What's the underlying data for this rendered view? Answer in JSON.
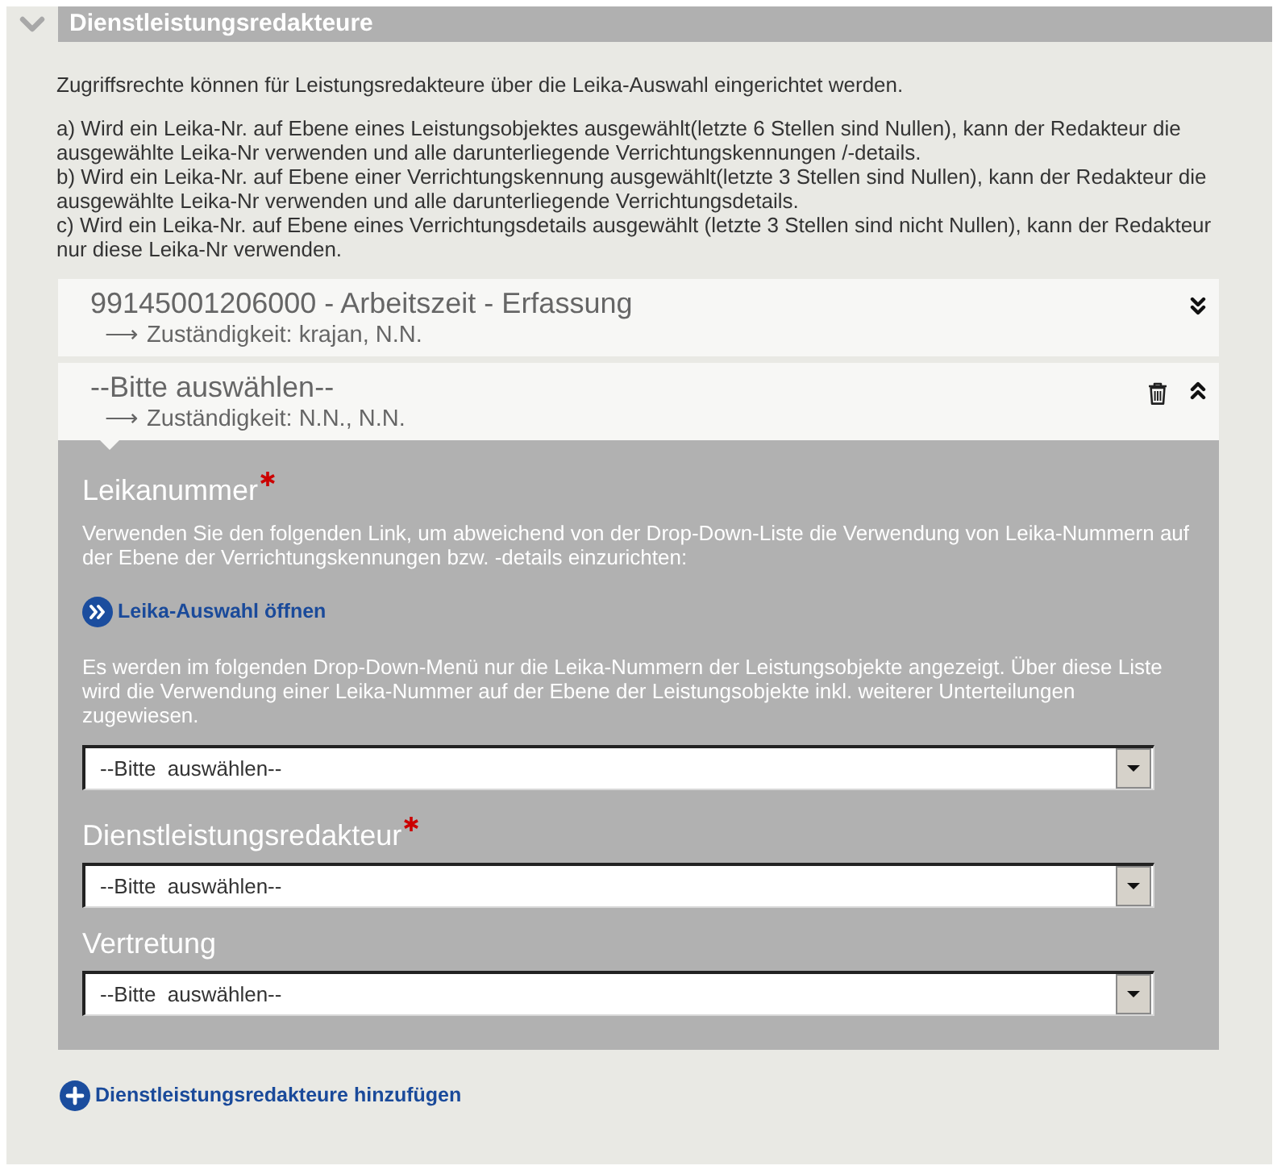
{
  "section": {
    "title": "Dienstleistungsredakteure",
    "expanded": true
  },
  "intro": "Zugriffsrechte können für Leistungsredakteure über die Leika-Auswahl eingerichtet werden.",
  "rules": [
    "a) Wird ein Leika-Nr. auf Ebene eines Leistungsobjektes ausgewählt(letzte 6 Stellen sind Nullen), kann der Redakteur die ausgewählte Leika-Nr verwenden und alle darunterliegende Verrichtungskennungen /-details.",
    "b) Wird ein Leika-Nr. auf Ebene einer Verrichtungskennung ausgewählt(letzte 3 Stellen sind Nullen), kann der Redakteur die ausgewählte Leika-Nr verwenden und alle darunterliegende Verrichtungsdetails.",
    "c) Wird ein Leika-Nr. auf Ebene eines Verrichtungsdetails ausgewählt (letzte 3 Stellen sind nicht Nullen), kann der Redakteur nur diese Leika-Nr verwenden."
  ],
  "entries": [
    {
      "title": "99145001206000 - Arbeitszeit - Erfassung",
      "responsibility": "⟶ Zuständigkeit: krajan, N.N.",
      "expanded": false,
      "deletable": false
    },
    {
      "title": "--Bitte auswählen--",
      "responsibility": "⟶ Zuständigkeit: N.N., N.N.",
      "expanded": true,
      "deletable": true,
      "form": {
        "fields": [
          {
            "label": "Leikanummer",
            "required": true,
            "help": "Verwenden Sie den folgenden Link, um abweichend von der Drop-Down-Liste die Verwendung von Leika-Nummern auf der Ebene der Verrichtungskennungen bzw. -details einzurichten:",
            "link": "Leika-Auswahl öffnen",
            "note": "Es werden im folgenden Drop-Down-Menü nur die Leika-Nummern der Leistungsobjekte angezeigt. Über diese Liste wird die Verwendung einer Leika-Nummer auf der Ebene der Leistungsobjekte inkl. weiterer Unterteilungen zugewiesen.",
            "select": {
              "value": "--Bitte  auswählen--"
            }
          },
          {
            "label": "Dienstleistungsredakteur",
            "required": true,
            "select": {
              "value": "--Bitte  auswählen--"
            }
          },
          {
            "label": "Vertretung",
            "required": false,
            "select": {
              "value": "--Bitte  auswählen--"
            }
          }
        ]
      }
    }
  ],
  "add_link": "Dienstleistungsredakteure hinzufügen"
}
